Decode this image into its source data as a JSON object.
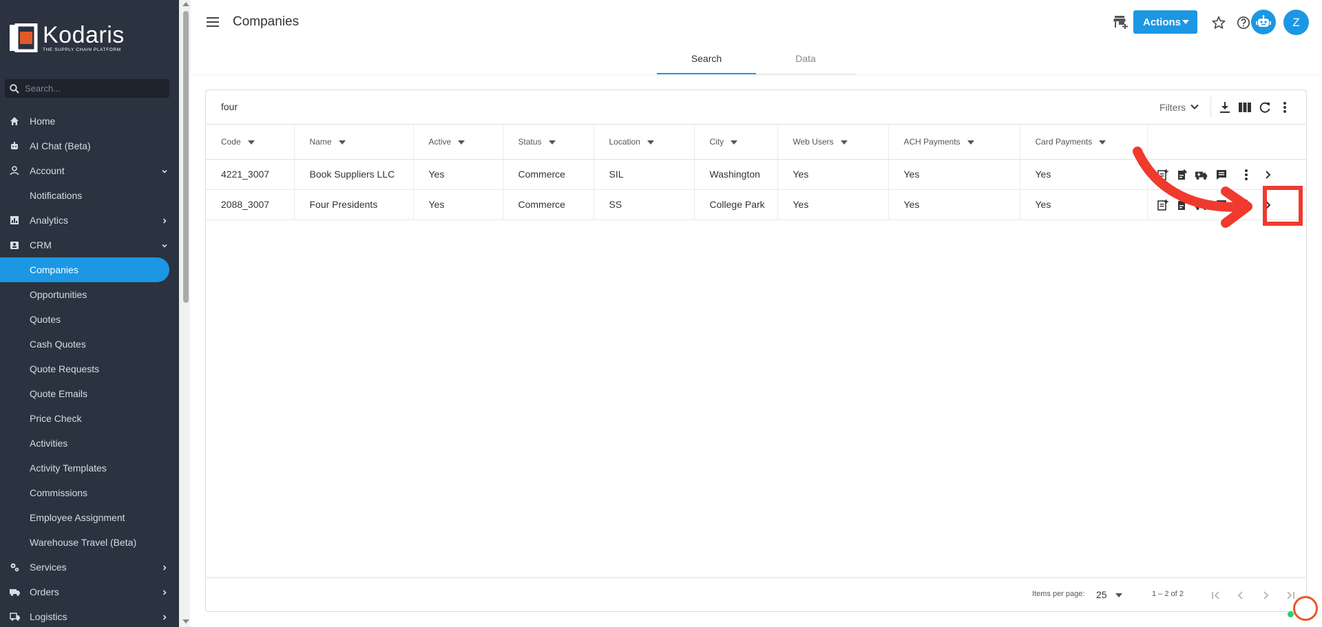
{
  "app": {
    "logo_name": "Kodaris",
    "logo_tagline": "THE SUPPLY CHAIN PLATFORM",
    "accent_color": "#1b97e4",
    "sidebar_color": "#2b3240"
  },
  "sidebar": {
    "search_placeholder": "Search...",
    "items": [
      {
        "label": "Home",
        "icon": "home-icon",
        "chevron": ""
      },
      {
        "label": "AI Chat (Beta)",
        "icon": "bot-icon",
        "chevron": ""
      },
      {
        "label": "Account",
        "icon": "person-icon",
        "chevron": "down"
      },
      {
        "label": "Notifications",
        "icon": "",
        "chevron": ""
      },
      {
        "label": "Analytics",
        "icon": "chart-icon",
        "chevron": "right"
      },
      {
        "label": "CRM",
        "icon": "contacts-icon",
        "chevron": "down"
      },
      {
        "label": "Companies",
        "icon": "",
        "chevron": "",
        "active": true
      },
      {
        "label": "Opportunities",
        "icon": "",
        "chevron": ""
      },
      {
        "label": "Quotes",
        "icon": "",
        "chevron": ""
      },
      {
        "label": "Cash Quotes",
        "icon": "",
        "chevron": ""
      },
      {
        "label": "Quote Requests",
        "icon": "",
        "chevron": ""
      },
      {
        "label": "Quote Emails",
        "icon": "",
        "chevron": ""
      },
      {
        "label": "Price Check",
        "icon": "",
        "chevron": ""
      },
      {
        "label": "Activities",
        "icon": "",
        "chevron": ""
      },
      {
        "label": "Activity Templates",
        "icon": "",
        "chevron": ""
      },
      {
        "label": "Commissions",
        "icon": "",
        "chevron": ""
      },
      {
        "label": "Employee Assignment",
        "icon": "",
        "chevron": ""
      },
      {
        "label": "Warehouse Travel (Beta)",
        "icon": "",
        "chevron": ""
      },
      {
        "label": "Services",
        "icon": "gears-icon",
        "chevron": "right"
      },
      {
        "label": "Orders",
        "icon": "truck-icon",
        "chevron": "right"
      },
      {
        "label": "Logistics",
        "icon": "shipping-icon",
        "chevron": "right"
      }
    ]
  },
  "header": {
    "title": "Companies",
    "actions_label": "Actions",
    "avatar_initial": "Z",
    "tabs": [
      {
        "label": "Search",
        "selected": true
      },
      {
        "label": "Data",
        "selected": false
      }
    ]
  },
  "search": {
    "query": "four",
    "filters_label": "Filters"
  },
  "table": {
    "columns": [
      "Code",
      "Name",
      "Active",
      "Status",
      "Location",
      "City",
      "Web Users",
      "ACH Payments",
      "Card Payments"
    ],
    "rows": [
      [
        "4221_3007",
        "Book Suppliers LLC",
        "Yes",
        "Commerce",
        "SIL",
        "Washington",
        "Yes",
        "Yes",
        "Yes"
      ],
      [
        "2088_3007",
        "Four Presidents",
        "Yes",
        "Commerce",
        "SS",
        "College Park",
        "Yes",
        "Yes",
        "Yes"
      ]
    ]
  },
  "paginator": {
    "items_per_page_label": "Items per page:",
    "page_size": "25",
    "range": "1 – 2 of 2"
  },
  "annotation_color": "#f03a2e"
}
